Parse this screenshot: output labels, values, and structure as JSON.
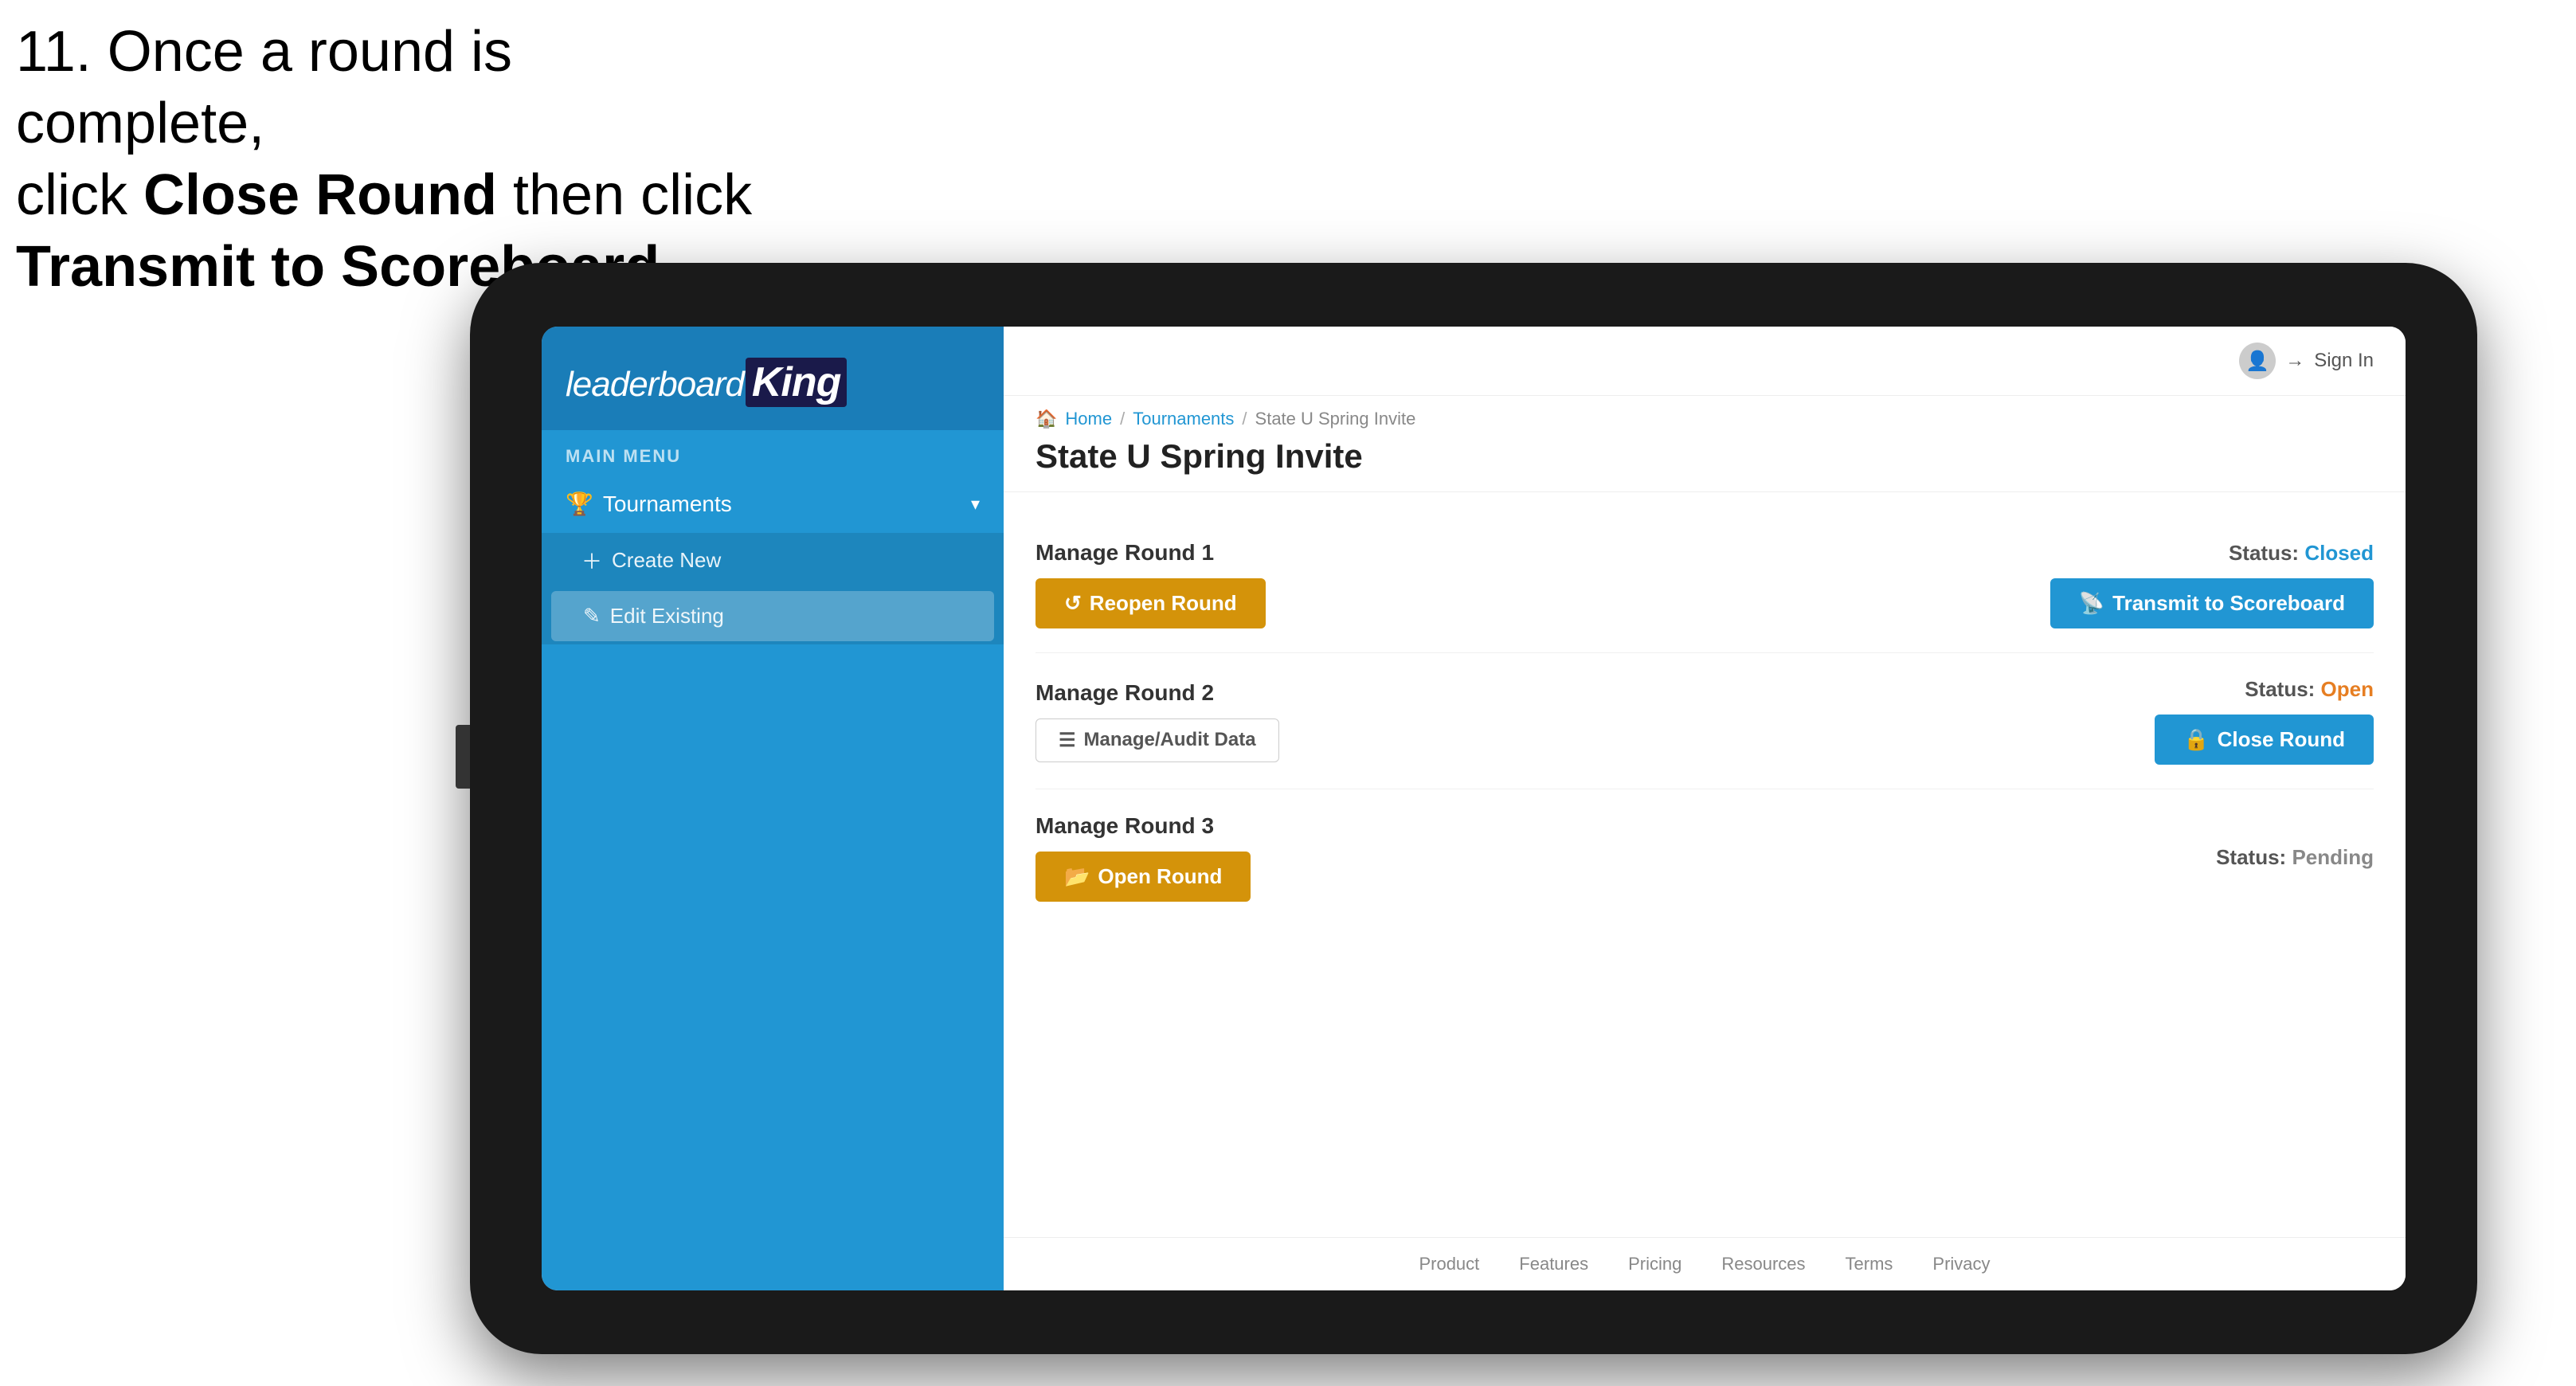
{
  "instruction": {
    "line1": "11. Once a round is complete,",
    "line2": "click ",
    "bold1": "Close Round",
    "line3": " then click",
    "bold2": "Transmit to Scoreboard."
  },
  "logo": {
    "leaderboard": "leaderboard",
    "king": "King"
  },
  "sidebar": {
    "main_menu_label": "MAIN MENU",
    "tournaments_label": "Tournaments",
    "create_new_label": "Create New",
    "edit_existing_label": "Edit Existing"
  },
  "topbar": {
    "signin_label": "Sign In"
  },
  "breadcrumb": {
    "home": "Home",
    "tournaments": "Tournaments",
    "current": "State U Spring Invite"
  },
  "page": {
    "title": "State U Spring Invite"
  },
  "rounds": [
    {
      "id": 1,
      "manage_label": "Manage Round 1",
      "status_label": "Status:",
      "status_value": "Closed",
      "status_class": "status-closed",
      "primary_btn_label": "Reopen Round",
      "primary_btn_type": "orange",
      "secondary_btn_label": "Transmit to Scoreboard",
      "secondary_btn_type": "blue",
      "has_audit": false
    },
    {
      "id": 2,
      "manage_label": "Manage Round 2",
      "status_label": "Status:",
      "status_value": "Open",
      "status_class": "status-open",
      "primary_btn_label": "Manage/Audit Data",
      "primary_btn_type": "outline",
      "secondary_btn_label": "Close Round",
      "secondary_btn_type": "blue",
      "has_audit": true
    },
    {
      "id": 3,
      "manage_label": "Manage Round 3",
      "status_label": "Status:",
      "status_value": "Pending",
      "status_class": "status-pending",
      "primary_btn_label": "Open Round",
      "primary_btn_type": "orange",
      "secondary_btn_label": null,
      "secondary_btn_type": null,
      "has_audit": false
    }
  ],
  "footer": {
    "links": [
      "Product",
      "Features",
      "Pricing",
      "Resources",
      "Terms",
      "Privacy"
    ]
  }
}
